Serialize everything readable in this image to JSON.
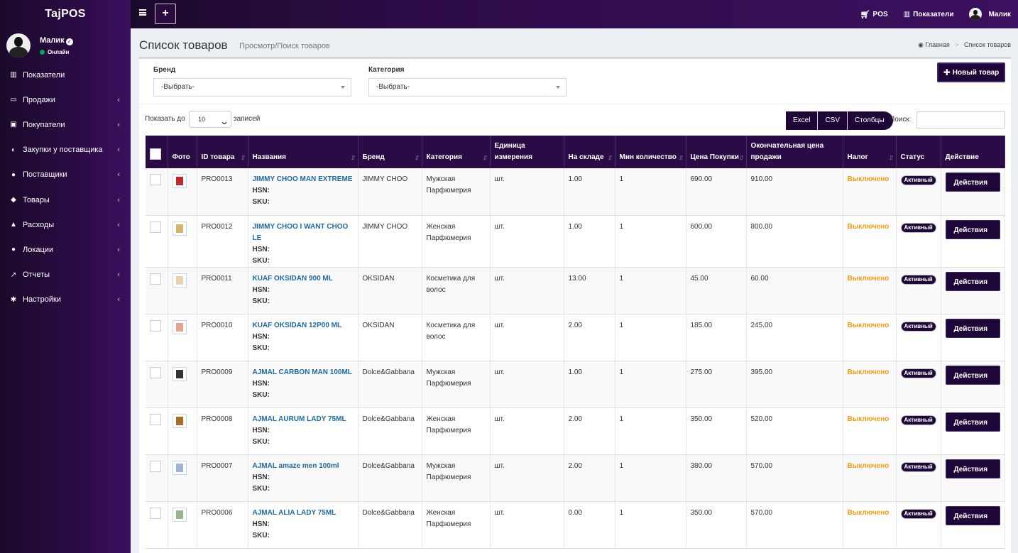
{
  "app": {
    "logo": "TajPOS"
  },
  "user": {
    "name": "Малик",
    "status": "Онлайн"
  },
  "sidebar": {
    "items": [
      {
        "label": "Показатели",
        "icon": "bar-chart-icon",
        "glyph": "▥",
        "has_children": false
      },
      {
        "label": "Продажи",
        "icon": "credit-card-icon",
        "glyph": "▭",
        "has_children": true
      },
      {
        "label": "Покупатели",
        "icon": "address-card-icon",
        "glyph": "▣",
        "has_children": true
      },
      {
        "label": "Закупки у поставщика",
        "icon": "handshake-icon",
        "glyph": "◐",
        "has_children": true
      },
      {
        "label": "Поставщики",
        "icon": "users-icon",
        "glyph": "●",
        "has_children": true
      },
      {
        "label": "Товары",
        "icon": "cube-icon",
        "glyph": "◆",
        "has_children": true
      },
      {
        "label": "Расходы",
        "icon": "area-chart-icon",
        "glyph": "▲",
        "has_children": true
      },
      {
        "label": "Локации",
        "icon": "globe-icon",
        "glyph": "●",
        "has_children": true
      },
      {
        "label": "Отчеты",
        "icon": "line-chart-icon",
        "glyph": "↗",
        "has_children": true
      },
      {
        "label": "Настройки",
        "icon": "cogs-icon",
        "glyph": "✱",
        "has_children": true
      }
    ]
  },
  "topbar": {
    "plus_label": "+",
    "pos_label": "POS",
    "dashboard_label": "Показатели",
    "user_label": "Малик"
  },
  "page": {
    "title": "Список товаров",
    "subtitle": "Просмотр/Поиск товаров"
  },
  "breadcrumb": {
    "home": "Главная",
    "sep": ">",
    "current": "Список товаров"
  },
  "filters": {
    "brand_label": "Бренд",
    "brand_value": "-Выбрать-",
    "category_label": "Категория",
    "category_value": "-Выбрать-",
    "new_button": "Новый товар"
  },
  "table_controls": {
    "show_prefix": "Показать до",
    "show_value": "10",
    "show_suffix": "записей",
    "excel": "Excel",
    "csv": "CSV",
    "columns": "Столбцы",
    "search_label": "Поиск:"
  },
  "table": {
    "headers": [
      "Фото",
      "ID товара",
      "Названия",
      "Бренд",
      "Категория",
      "Единица измерения",
      "На складе",
      "Мин количество",
      "Цена Покупки",
      "Окончательная цена продажи",
      "Налог",
      "Статус",
      "Действие"
    ],
    "hsn_label": "HSN:",
    "sku_label": "SKU:",
    "rows": [
      {
        "id": "PRO0013",
        "name": "JIMMY CHOO MAN EXTREME",
        "brand": "JIMMY CHOO",
        "category": "Мужская Парфюмерия",
        "unit": "шт.",
        "stock": "1.00",
        "min": "1",
        "buy": "690.00",
        "sell": "910.00",
        "tax": "Выключено",
        "status": "Активный",
        "action": "Действия",
        "photo_color": "#c0282d"
      },
      {
        "id": "PRO0012",
        "name": "JIMMY CHOO I WANT CHOO LE",
        "brand": "JIMMY CHOO",
        "category": "Женская Парфюмерия",
        "unit": "шт.",
        "stock": "1.00",
        "min": "1",
        "buy": "600.00",
        "sell": "800.00",
        "tax": "Выключено",
        "status": "Активный",
        "action": "Действия",
        "photo_color": "#d8b46a"
      },
      {
        "id": "PRO0011",
        "name": "KUAF OKSIDAN 900 ML",
        "brand": "OKSIDAN",
        "category": "Косметика для волос",
        "unit": "шт.",
        "stock": "13.00",
        "min": "1",
        "buy": "45.00",
        "sell": "60.00",
        "tax": "Выключено",
        "status": "Активный",
        "action": "Действия",
        "photo_color": "#e8d2b0"
      },
      {
        "id": "PRO0010",
        "name": "KUAF OKSIDAN 12P00 ML",
        "brand": "OKSIDAN",
        "category": "Косметика для волос",
        "unit": "шт.",
        "stock": "2.00",
        "min": "1",
        "buy": "185.00",
        "sell": "245.00",
        "tax": "Выключено",
        "status": "Активный",
        "action": "Действия",
        "photo_color": "#e9a38f"
      },
      {
        "id": "PRO0009",
        "name": "AJMAL CARBON MAN 100ML",
        "brand": "Dolce&Gabbana",
        "category": "Мужская Парфюмерия",
        "unit": "шт.",
        "stock": "1.00",
        "min": "1",
        "buy": "275.00",
        "sell": "395.00",
        "tax": "Выключено",
        "status": "Активный",
        "action": "Действия",
        "photo_color": "#333333"
      },
      {
        "id": "PRO0008",
        "name": "AJMAL AURUM LADY 75ML",
        "brand": "Dolce&Gabbana",
        "category": "Женская Парфюмерия",
        "unit": "шт.",
        "stock": "2.00",
        "min": "1",
        "buy": "350.00",
        "sell": "520.00",
        "tax": "Выключено",
        "status": "Активный",
        "action": "Действия",
        "photo_color": "#a86d24"
      },
      {
        "id": "PRO0007",
        "name": "AJMAL amaze men 100ml",
        "brand": "Dolce&Gabbana",
        "category": "Мужская Парфюмерия",
        "unit": "шт.",
        "stock": "2.00",
        "min": "1",
        "buy": "380.00",
        "sell": "570.00",
        "tax": "Выключено",
        "status": "Активный",
        "action": "Действия",
        "photo_color": "#9fb3d8"
      },
      {
        "id": "PRO0006",
        "name": "AJMAL ALIA LADY 75ML",
        "brand": "Dolce&Gabbana",
        "category": "Женская Парфюмерия",
        "unit": "шт.",
        "stock": "0.00",
        "min": "1",
        "buy": "350.00",
        "sell": "570.00",
        "tax": "Выключено",
        "status": "Активный",
        "action": "Действия",
        "photo_color": "#9bb58a"
      }
    ]
  }
}
